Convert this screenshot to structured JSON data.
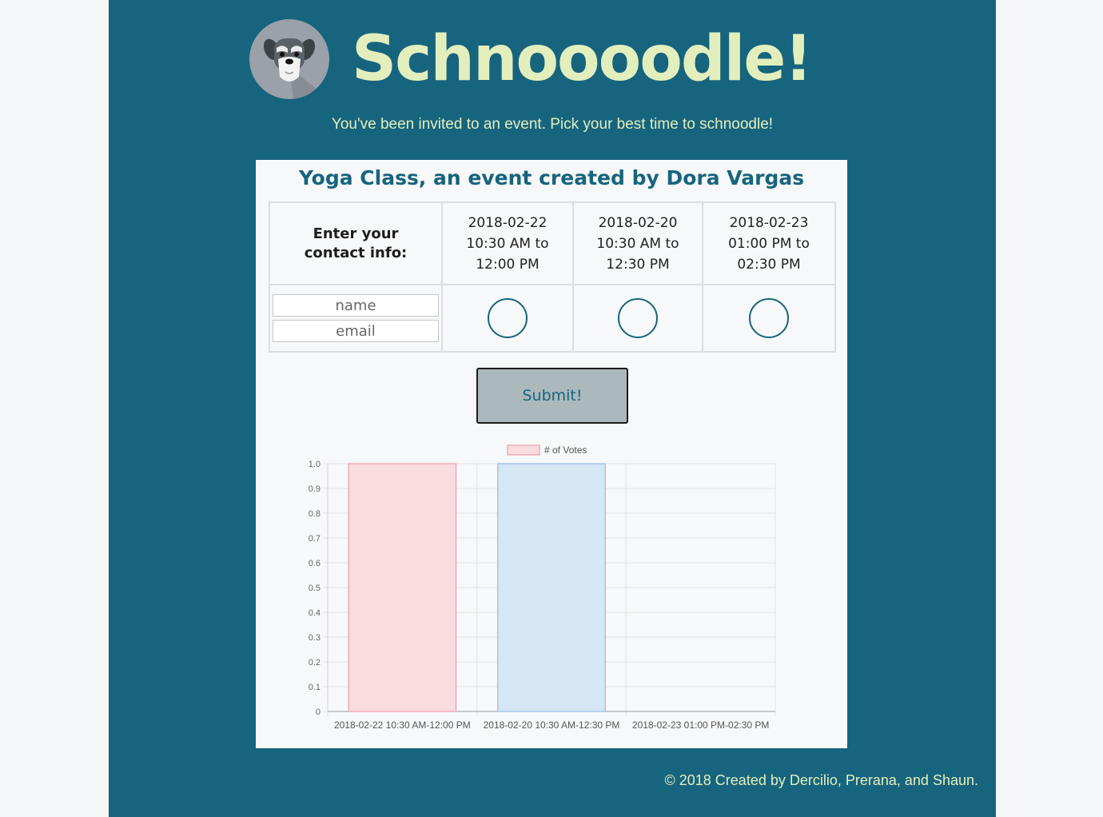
{
  "app": {
    "title": "Schnoooodle!",
    "tagline": "You've been invited to an event. Pick your best time to schnoodle!"
  },
  "event": {
    "title": "Yoga Class, an event created by Dora Vargas",
    "contact_label_line1": "Enter your",
    "contact_label_line2": "contact info:",
    "name_placeholder": "name",
    "email_placeholder": "email",
    "slots": [
      {
        "date": "2018-02-22",
        "start": "10:30 AM to",
        "end": "12:00 PM"
      },
      {
        "date": "2018-02-20",
        "start": "10:30 AM to",
        "end": "12:30 PM"
      },
      {
        "date": "2018-02-23",
        "start": "01:00 PM to",
        "end": "02:30 PM"
      }
    ],
    "submit_label": "Submit!"
  },
  "chart_data": {
    "type": "bar",
    "categories": [
      "2018-02-22 10:30 AM-12:00 PM",
      "2018-02-20 10:30 AM-12:30 PM",
      "2018-02-23 01:00 PM-02:30 PM"
    ],
    "series": [
      {
        "name": "# of Votes",
        "values": [
          1,
          1,
          0
        ]
      }
    ],
    "bar_colors": [
      "#f9dbe0",
      "#d5e6f4",
      "#fdf1d8"
    ],
    "bar_borders": [
      "#ec8fa1",
      "#7fb3e3",
      "#f0c36e"
    ],
    "legend_color": "#f9dbe0",
    "legend_border": "#ec8fa1",
    "ylim": [
      0,
      1
    ],
    "yticks": [
      "0",
      "0.1",
      "0.2",
      "0.3",
      "0.4",
      "0.5",
      "0.6",
      "0.7",
      "0.8",
      "0.9",
      "1.0"
    ],
    "grid": true,
    "legend_position": "top"
  },
  "footer": {
    "text": "© 2018 Created by Dercilio, Prerana, and Shaun."
  }
}
